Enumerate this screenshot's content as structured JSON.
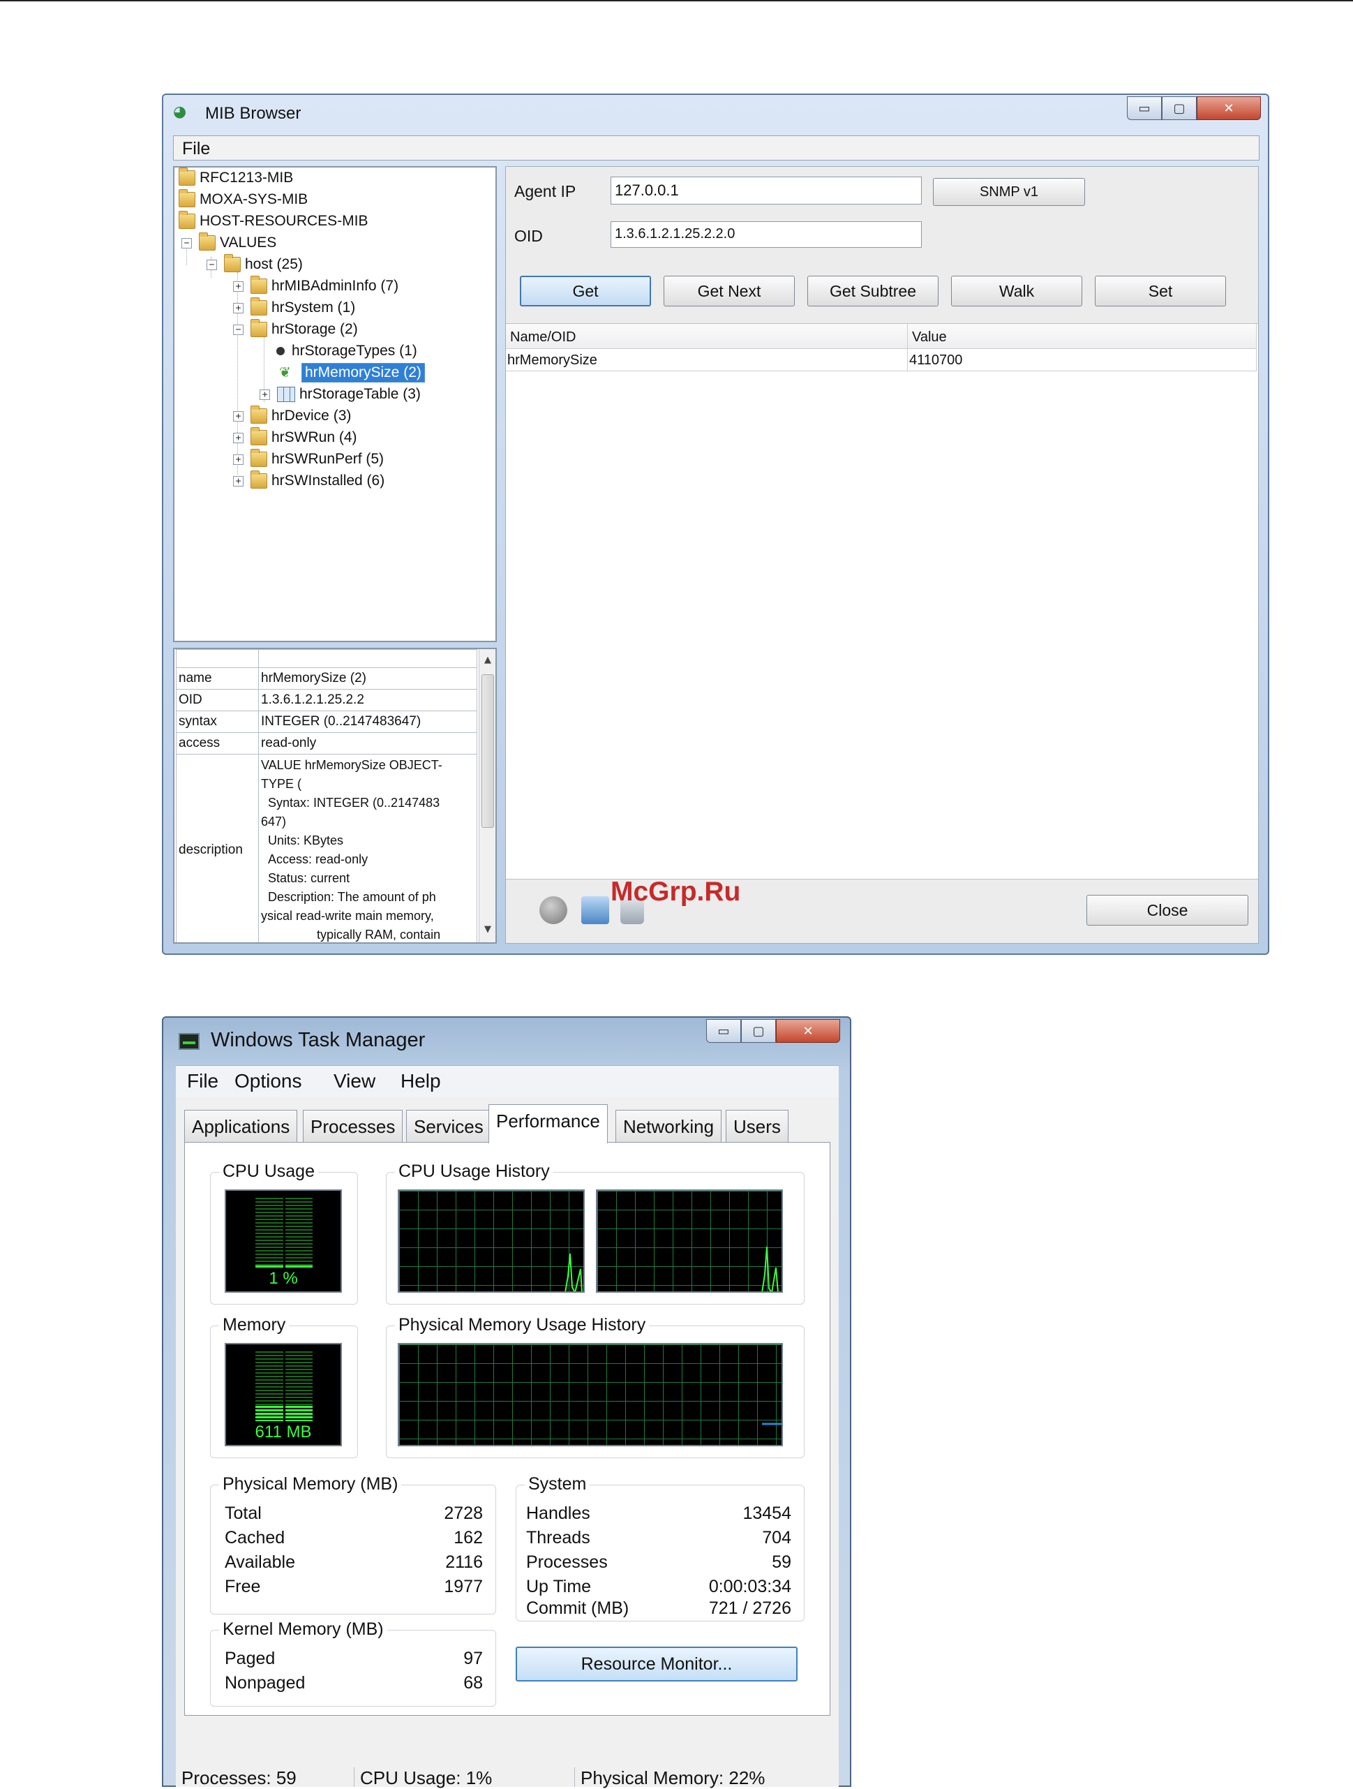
{
  "mib_browser": {
    "title": "MIB Browser",
    "menu": {
      "file": "File"
    },
    "window_buttons": {
      "minimize": "▭",
      "maximize": "▢",
      "close": "✕"
    },
    "tree": {
      "rfc1213": "RFC1213-MIB",
      "moxa": "MOXA-SYS-MIB",
      "host_resources": "HOST-RESOURCES-MIB",
      "values": "VALUES",
      "host": "host (25)",
      "hrMIBAdminInfo": "hrMIBAdminInfo (7)",
      "hrSystem": "hrSystem (1)",
      "hrStorage": "hrStorage (2)",
      "hrStorageTypes": "hrStorageTypes (1)",
      "hrMemorySize": "hrMemorySize (2)",
      "hrStorageTable": "hrStorageTable (3)",
      "hrDevice": "hrDevice (3)",
      "hrSWRun": "hrSWRun (4)",
      "hrSWRunPerf": "hrSWRunPerf (5)",
      "hrSWInstalled": "hrSWInstalled (6)"
    },
    "properties": {
      "name_key": "name",
      "name_val": "hrMemorySize (2)",
      "oid_key": "OID",
      "oid_val": "1.3.6.1.2.1.25.2.2",
      "syntax_key": "syntax",
      "syntax_val": "INTEGER (0..2147483647)",
      "access_key": "access",
      "access_val": "read-only",
      "description_key": "description",
      "description_val": "VALUE hrMemorySize OBJECT-\nTYPE (\n  Syntax: INTEGER (0..2147483\n647)\n  Units: KBytes\n  Access: read-only\n  Status: current\n  Description: The amount of ph\nysical read-write main memory,\n                typically RAM, contain"
    },
    "form": {
      "agent_ip_label": "Agent IP",
      "agent_ip_value": "127.0.0.1",
      "snmp_version": "SNMP v1",
      "oid_label": "OID",
      "oid_value": "1.3.6.1.2.1.25.2.2.0"
    },
    "actions": {
      "get": "Get",
      "get_next": "Get Next",
      "get_subtree": "Get Subtree",
      "walk": "Walk",
      "set": "Set"
    },
    "results": {
      "columns": [
        "Name/OID",
        "Value"
      ],
      "rows": [
        {
          "name": "hrMemorySize",
          "value": "4110700"
        }
      ]
    },
    "close_label": "Close"
  },
  "watermark": "McGrp.Ru",
  "task_manager": {
    "title": "Windows Task Manager",
    "menu": [
      "File",
      "Options",
      "View",
      "Help"
    ],
    "tabs": [
      "Applications",
      "Processes",
      "Services",
      "Performance",
      "Networking",
      "Users"
    ],
    "cpu_usage": {
      "label": "CPU Usage",
      "value": "1 %",
      "level": 0.01
    },
    "cpu_history_label": "CPU Usage History",
    "memory": {
      "label": "Memory",
      "value": "611 MB",
      "level": 0.22
    },
    "physical_memory_history_label": "Physical Memory Usage History",
    "physical_memory": {
      "label": "Physical Memory (MB)",
      "total_label": "Total",
      "total": "2728",
      "cached_label": "Cached",
      "cached": "162",
      "available_label": "Available",
      "available": "2116",
      "free_label": "Free",
      "free": "1977"
    },
    "kernel_memory": {
      "label": "Kernel Memory (MB)",
      "paged_label": "Paged",
      "paged": "97",
      "nonpaged_label": "Nonpaged",
      "nonpaged": "68"
    },
    "system": {
      "label": "System",
      "handles_label": "Handles",
      "handles": "13454",
      "threads_label": "Threads",
      "threads": "704",
      "processes_label": "Processes",
      "processes": "59",
      "uptime_label": "Up Time",
      "uptime": "0:00:03:34",
      "commit_label": "Commit (MB)",
      "commit": "721 / 2726"
    },
    "resource_monitor": "Resource Monitor...",
    "status": {
      "processes": "Processes: 59",
      "cpu": "CPU Usage: 1%",
      "memory": "Physical Memory: 22%"
    },
    "colors": {
      "graph_line": "#3cff3c",
      "grid": "#1f7a3f",
      "memory_line": "#2f7fd6"
    }
  }
}
